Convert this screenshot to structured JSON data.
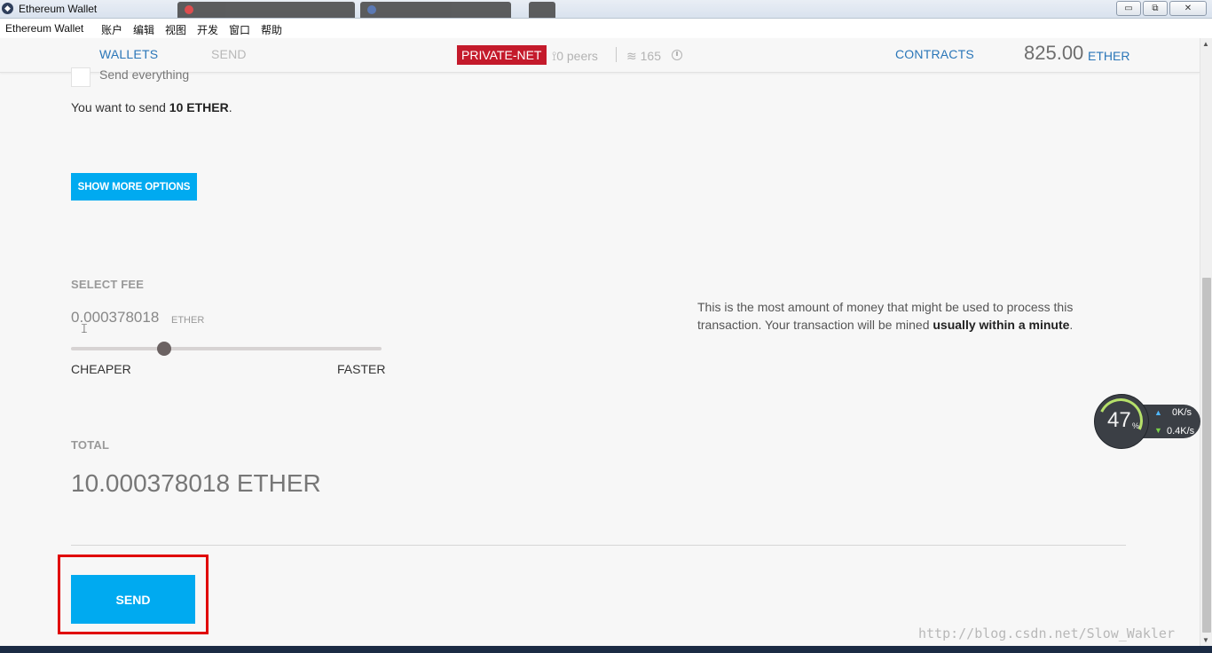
{
  "window": {
    "title": "Ethereum Wallet",
    "controls": {
      "minimize": "▭",
      "restore": "⧉",
      "close": "✕"
    }
  },
  "menubar": {
    "items": [
      "Ethereum Wallet",
      "账户",
      "编辑",
      "视图",
      "开发",
      "窗口",
      "帮助"
    ]
  },
  "header": {
    "nav": {
      "wallets": "WALLETS",
      "send": "SEND",
      "contracts": "CONTRACTS"
    },
    "network": "PRIVATE-NET",
    "peers": "0 peers",
    "block": "165",
    "balance": {
      "amount": "825.00",
      "unit": "ETHER"
    }
  },
  "send_form": {
    "send_everything_label": "Send everything",
    "want_send_prefix": "You want to send ",
    "want_send_amount": "10 ETHER",
    "want_send_suffix": ".",
    "show_more_options": "SHOW MORE OPTIONS",
    "select_fee_label": "SELECT FEE",
    "fee_value": "0.000378018",
    "fee_unit": "ETHER",
    "slider": {
      "cheaper": "CHEAPER",
      "faster": "FASTER",
      "position": 0.3
    },
    "fee_info_prefix": "This is the most amount of money that might be used to process this transaction. Your transaction will be mined ",
    "fee_info_bold": "usually within a minute",
    "fee_info_suffix": ".",
    "total_label": "TOTAL",
    "total_value": "10.000378018 ETHER",
    "send_button": "SEND"
  },
  "net_widget": {
    "percent": "47",
    "percent_sign": "%",
    "upload": "0K/s",
    "download": "0.4K/s"
  },
  "watermark": "http://blog.csdn.net/Slow_Wakler",
  "colors": {
    "accent": "#00aaf0",
    "nav_link": "#2a76b8",
    "network_badge": "#c41a2b",
    "highlight": "#e00000"
  }
}
